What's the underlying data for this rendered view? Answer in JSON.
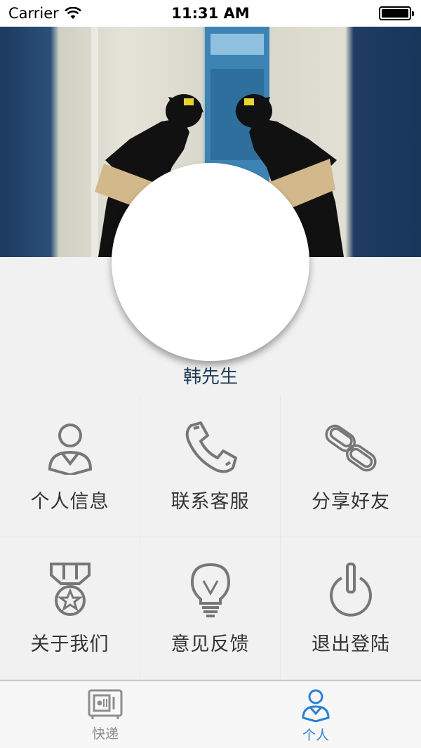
{
  "status_bar": {
    "carrier": "Carrier",
    "time": "11:31 AM"
  },
  "profile": {
    "name": "韩先生"
  },
  "menu": [
    {
      "label": "个人信息",
      "icon": "person-icon"
    },
    {
      "label": "联系客服",
      "icon": "phone-icon"
    },
    {
      "label": "分享好友",
      "icon": "link-icon"
    },
    {
      "label": "关于我们",
      "icon": "medal-icon"
    },
    {
      "label": "意见反馈",
      "icon": "lightbulb-icon"
    },
    {
      "label": "退出登陆",
      "icon": "power-icon"
    }
  ],
  "tabs": [
    {
      "label": "快递",
      "icon": "locker-icon",
      "active": false
    },
    {
      "label": "个人",
      "icon": "user-icon",
      "active": true
    }
  ],
  "colors": {
    "accent": "#2b7fd4",
    "icon_gray": "#777777",
    "name_text": "#1f3a57"
  }
}
